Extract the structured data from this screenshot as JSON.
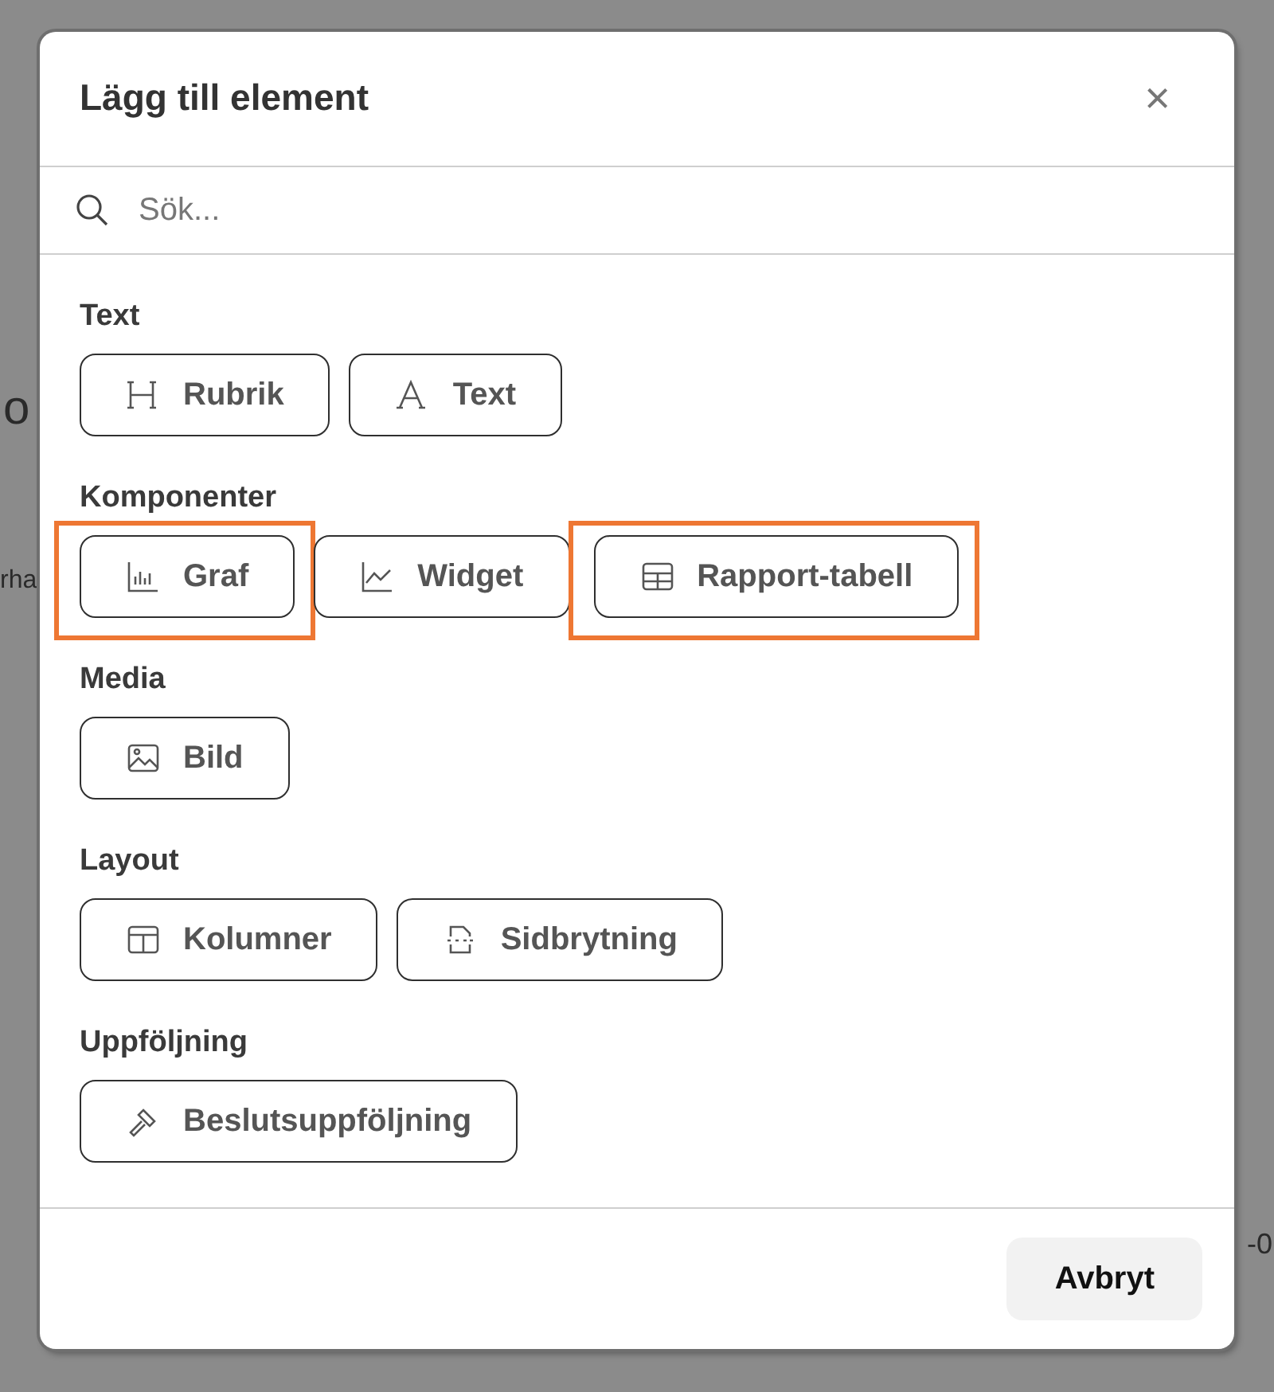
{
  "background": {
    "left_fragments": [
      "o",
      "rha"
    ],
    "right_fragments": [
      "-0"
    ]
  },
  "dialog": {
    "title": "Lägg till element",
    "close": "×",
    "search": {
      "placeholder": "Sök..."
    },
    "sections": [
      {
        "title": "Text",
        "items": [
          {
            "label": "Rubrik",
            "highlighted": false
          },
          {
            "label": "Text",
            "highlighted": false
          }
        ]
      },
      {
        "title": "Komponenter",
        "items": [
          {
            "label": "Graf",
            "highlighted": true
          },
          {
            "label": "Widget",
            "highlighted": false
          },
          {
            "label": "Rapport-tabell",
            "highlighted": true
          }
        ]
      },
      {
        "title": "Media",
        "items": [
          {
            "label": "Bild",
            "highlighted": false
          }
        ]
      },
      {
        "title": "Layout",
        "items": [
          {
            "label": "Kolumner",
            "highlighted": false
          },
          {
            "label": "Sidbrytning",
            "highlighted": false
          }
        ]
      },
      {
        "title": "Uppföljning",
        "items": [
          {
            "label": "Beslutsuppföljning",
            "highlighted": false
          }
        ]
      }
    ],
    "cancel": "Avbryt"
  }
}
